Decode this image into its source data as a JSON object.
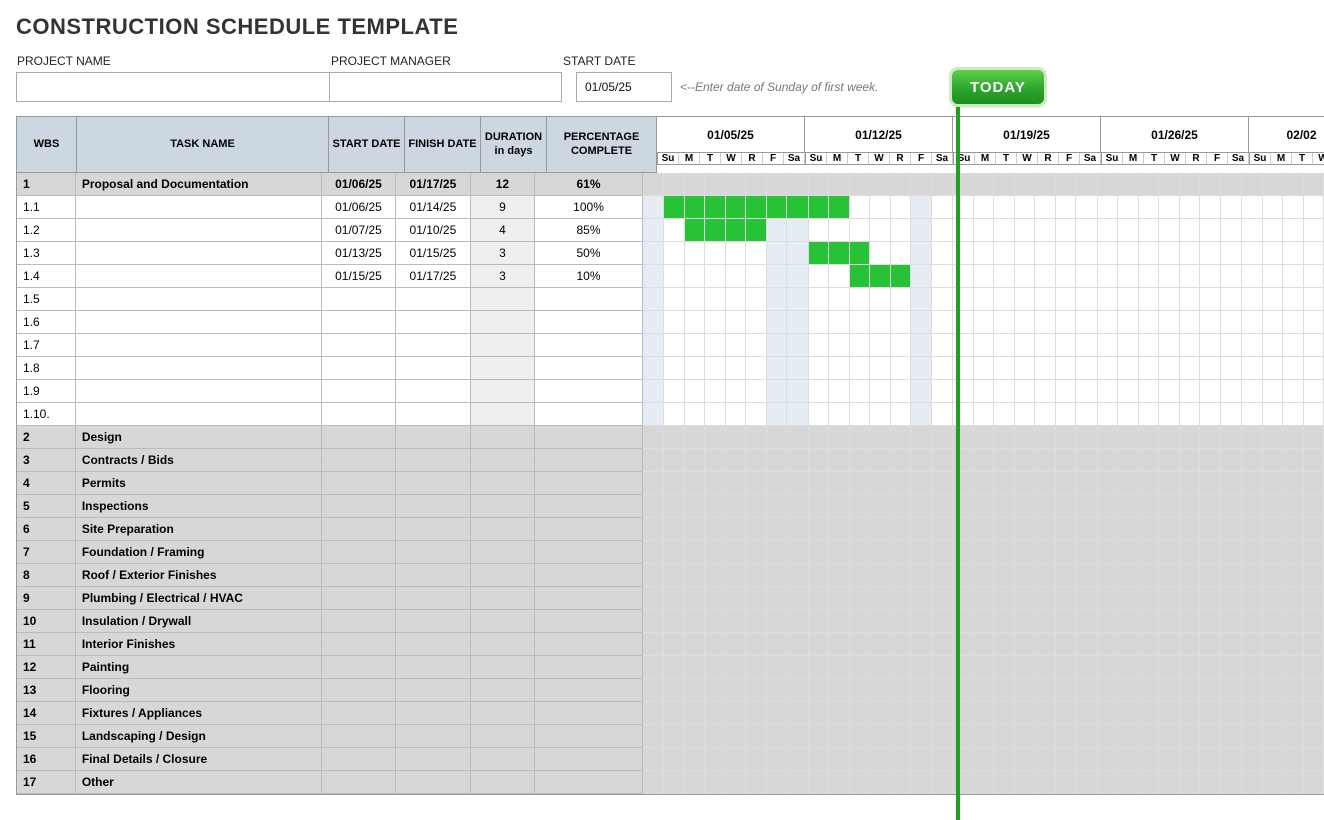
{
  "title": "CONSTRUCTION SCHEDULE TEMPLATE",
  "labels": {
    "project_name": "PROJECT NAME",
    "project_manager": "PROJECT MANAGER",
    "start_date": "START DATE"
  },
  "inputs": {
    "project_name": "",
    "project_manager": "",
    "start_date": "01/05/25"
  },
  "hint": "<--Enter date of Sunday of first week.",
  "today_label": "TODAY",
  "columns": {
    "wbs": "WBS",
    "task": "TASK NAME",
    "start": "START DATE",
    "finish": "FINISH DATE",
    "duration": "DURATION",
    "duration_sub": "in days",
    "pct": "PERCENTAGE COMPLETE"
  },
  "day_abbrev": [
    "Su",
    "M",
    "T",
    "W",
    "R",
    "F",
    "Sa"
  ],
  "weeks": [
    "01/05/25",
    "01/12/25",
    "01/19/25",
    "01/26/25",
    "02/02"
  ],
  "rows": [
    {
      "wbs": "1",
      "task": "Proposal and Documentation",
      "start": "01/06/25",
      "finish": "01/17/25",
      "duration": "12",
      "pct": "61%",
      "section": true,
      "bar": []
    },
    {
      "wbs": "1.1",
      "task": "",
      "start": "01/06/25",
      "finish": "01/14/25",
      "duration": "9",
      "pct": "100%",
      "section": false,
      "bar": [
        1,
        2,
        3,
        4,
        5,
        6,
        7,
        8,
        9
      ]
    },
    {
      "wbs": "1.2",
      "task": "",
      "start": "01/07/25",
      "finish": "01/10/25",
      "duration": "4",
      "pct": "85%",
      "section": false,
      "bar": [
        2,
        3,
        4,
        5
      ]
    },
    {
      "wbs": "1.3",
      "task": "",
      "start": "01/13/25",
      "finish": "01/15/25",
      "duration": "3",
      "pct": "50%",
      "section": false,
      "bar": [
        8,
        9,
        10
      ]
    },
    {
      "wbs": "1.4",
      "task": "",
      "start": "01/15/25",
      "finish": "01/17/25",
      "duration": "3",
      "pct": "10%",
      "section": false,
      "bar": [
        10,
        11,
        12
      ]
    },
    {
      "wbs": "1.5",
      "task": "",
      "start": "",
      "finish": "",
      "duration": "",
      "pct": "",
      "section": false,
      "bar": []
    },
    {
      "wbs": "1.6",
      "task": "",
      "start": "",
      "finish": "",
      "duration": "",
      "pct": "",
      "section": false,
      "bar": []
    },
    {
      "wbs": "1.7",
      "task": "",
      "start": "",
      "finish": "",
      "duration": "",
      "pct": "",
      "section": false,
      "bar": []
    },
    {
      "wbs": "1.8",
      "task": "",
      "start": "",
      "finish": "",
      "duration": "",
      "pct": "",
      "section": false,
      "bar": []
    },
    {
      "wbs": "1.9",
      "task": "",
      "start": "",
      "finish": "",
      "duration": "",
      "pct": "",
      "section": false,
      "bar": []
    },
    {
      "wbs": "1.10.",
      "task": "",
      "start": "",
      "finish": "",
      "duration": "",
      "pct": "",
      "section": false,
      "bar": []
    },
    {
      "wbs": "2",
      "task": "Design",
      "section": true
    },
    {
      "wbs": "3",
      "task": "Contracts / Bids",
      "section": true
    },
    {
      "wbs": "4",
      "task": "Permits",
      "section": true
    },
    {
      "wbs": "5",
      "task": "Inspections",
      "section": true
    },
    {
      "wbs": "6",
      "task": "Site Preparation",
      "section": true
    },
    {
      "wbs": "7",
      "task": "Foundation / Framing",
      "section": true
    },
    {
      "wbs": "8",
      "task": "Roof / Exterior Finishes",
      "section": true
    },
    {
      "wbs": "9",
      "task": "Plumbing / Electrical / HVAC",
      "section": true
    },
    {
      "wbs": "10",
      "task": "Insulation / Drywall",
      "section": true
    },
    {
      "wbs": "11",
      "task": "Interior Finishes",
      "section": true
    },
    {
      "wbs": "12",
      "task": "Painting",
      "section": true
    },
    {
      "wbs": "13",
      "task": "Flooring",
      "section": true
    },
    {
      "wbs": "14",
      "task": "Fixtures / Appliances",
      "section": true
    },
    {
      "wbs": "15",
      "task": "Landscaping / Design",
      "section": true
    },
    {
      "wbs": "16",
      "task": "Final Details / Closure",
      "section": true
    },
    {
      "wbs": "17",
      "task": "Other",
      "section": true
    }
  ]
}
